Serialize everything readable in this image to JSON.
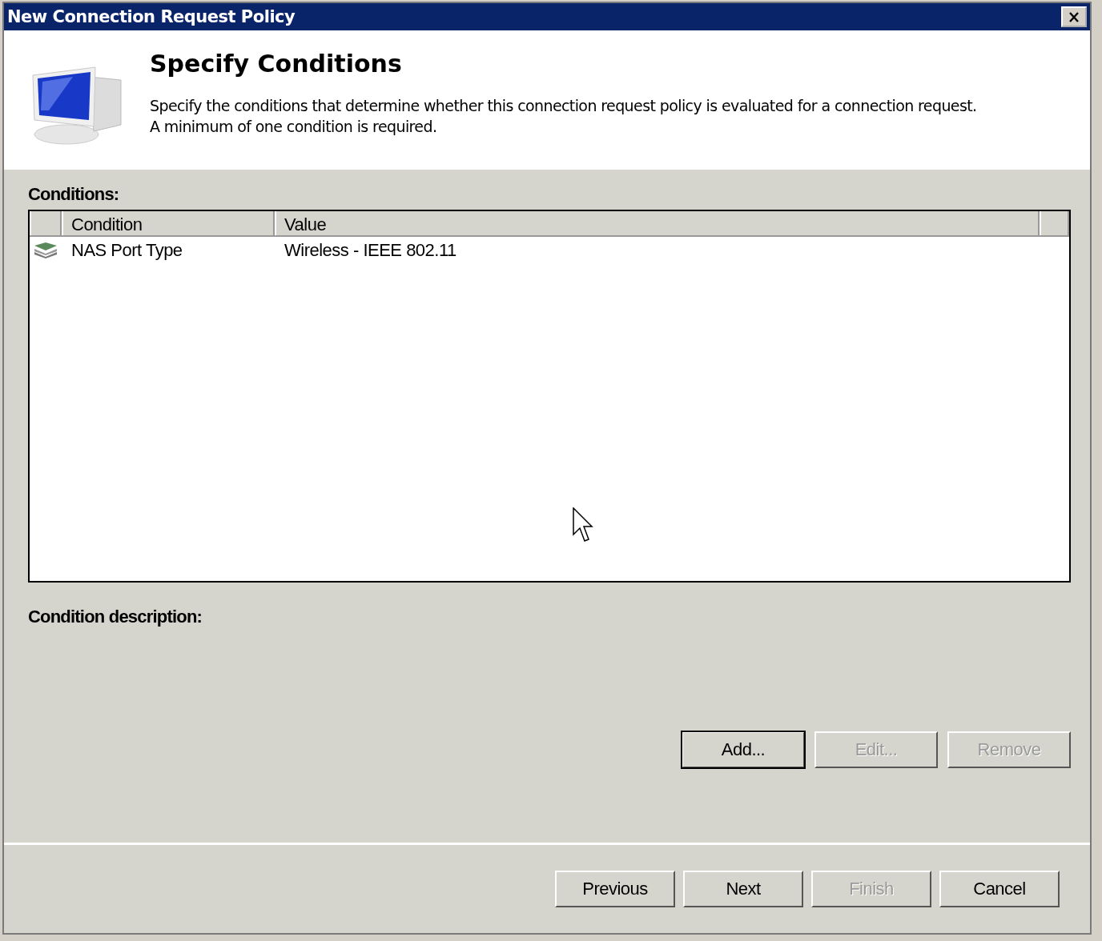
{
  "window": {
    "title": "New Connection Request Policy"
  },
  "header": {
    "title": "Specify Conditions",
    "description": "Specify the conditions that determine whether this connection request policy is evaluated for a connection request.\nA minimum of one condition is required."
  },
  "conditions": {
    "label": "Conditions:",
    "columns": [
      "Condition",
      "Value"
    ],
    "rows": [
      {
        "condition": "NAS Port Type",
        "value": "Wireless - IEEE 802.11",
        "selected": false
      }
    ]
  },
  "condition_description": {
    "label": "Condition description:"
  },
  "condition_buttons": [
    {
      "label": "Add...",
      "default": true,
      "disabled": false
    },
    {
      "label": "Edit...",
      "default": false,
      "disabled": true
    },
    {
      "label": "Remove",
      "default": false,
      "disabled": true
    }
  ],
  "wizard_buttons": [
    {
      "label": "Previous",
      "default": false,
      "disabled": false
    },
    {
      "label": "Next",
      "default": false,
      "disabled": false
    },
    {
      "label": "Finish",
      "default": false,
      "disabled": true
    },
    {
      "label": "Cancel",
      "default": false,
      "disabled": false
    }
  ]
}
